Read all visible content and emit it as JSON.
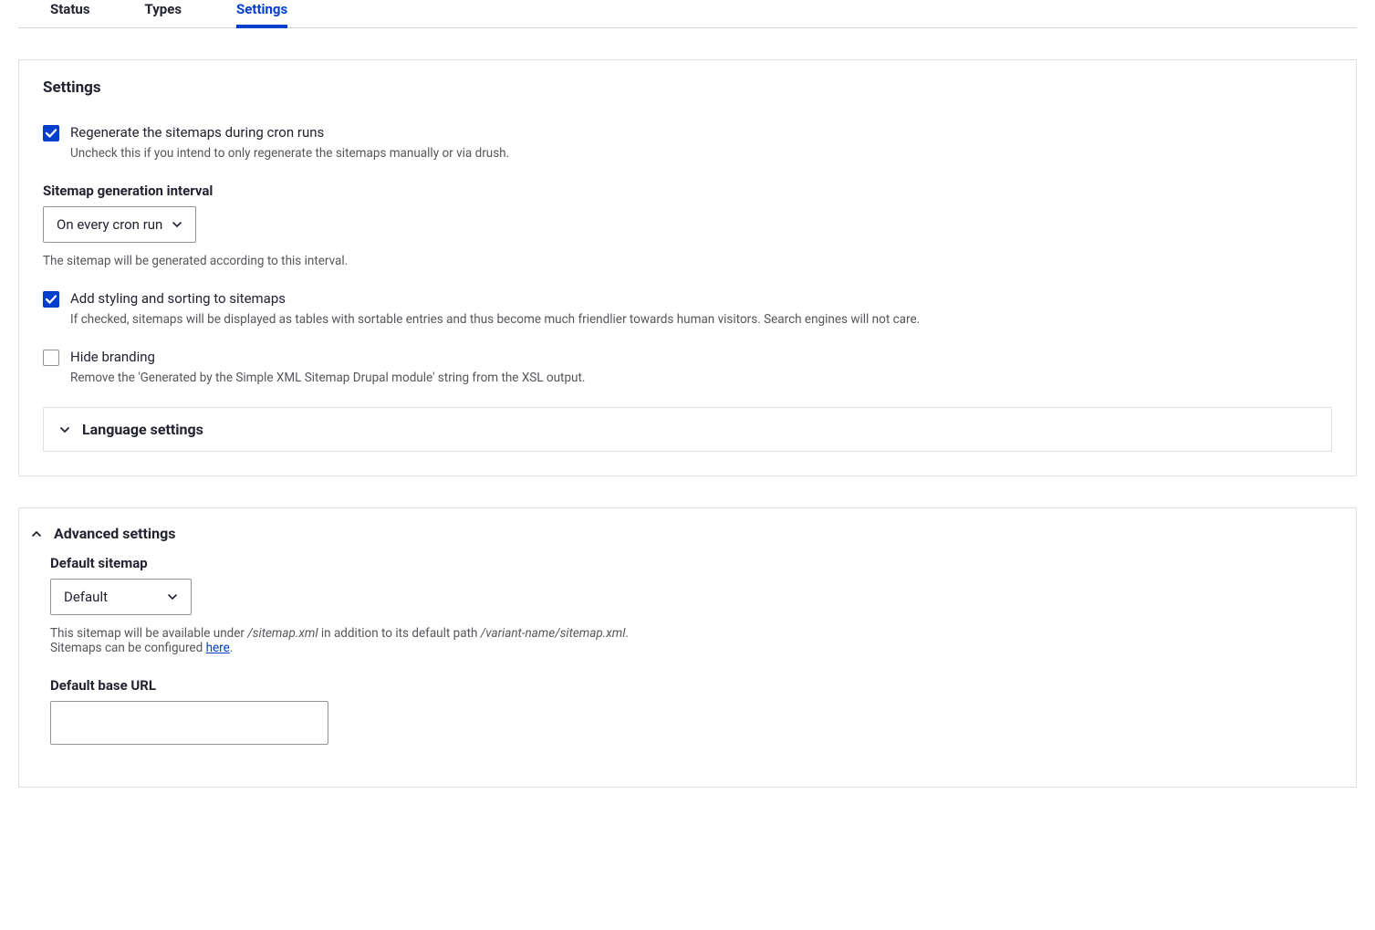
{
  "tabs": {
    "status": "Status",
    "types": "Types",
    "settings": "Settings"
  },
  "panel": {
    "title": "Settings",
    "cron_regen": {
      "label": "Regenerate the sitemaps during cron runs",
      "desc": "Uncheck this if you intend to only regenerate the sitemaps manually or via drush."
    },
    "interval": {
      "label": "Sitemap generation interval",
      "value": "On every cron run",
      "desc": "The sitemap will be generated according to this interval."
    },
    "styling": {
      "label": "Add styling and sorting to sitemaps",
      "desc": "If checked, sitemaps will be displayed as tables with sortable entries and thus become much friendlier towards human visitors. Search engines will not care."
    },
    "hide_brand": {
      "label": "Hide branding",
      "desc": "Remove the 'Generated by the Simple XML Sitemap Drupal module' string from the XSL output."
    },
    "lang_settings": "Language settings"
  },
  "advanced": {
    "title": "Advanced settings",
    "default_sitemap": {
      "label": "Default sitemap",
      "value": "Default",
      "desc_pre": "This sitemap will be available under ",
      "path1": "/sitemap.xml",
      "desc_mid": " in addition to its default path ",
      "path2": "/variant-name/sitemap.xml",
      "desc_post": ".",
      "line2_pre": "Sitemaps can be configured ",
      "here": "here",
      "line2_post": "."
    },
    "base_url": {
      "label": "Default base URL",
      "value": ""
    }
  }
}
